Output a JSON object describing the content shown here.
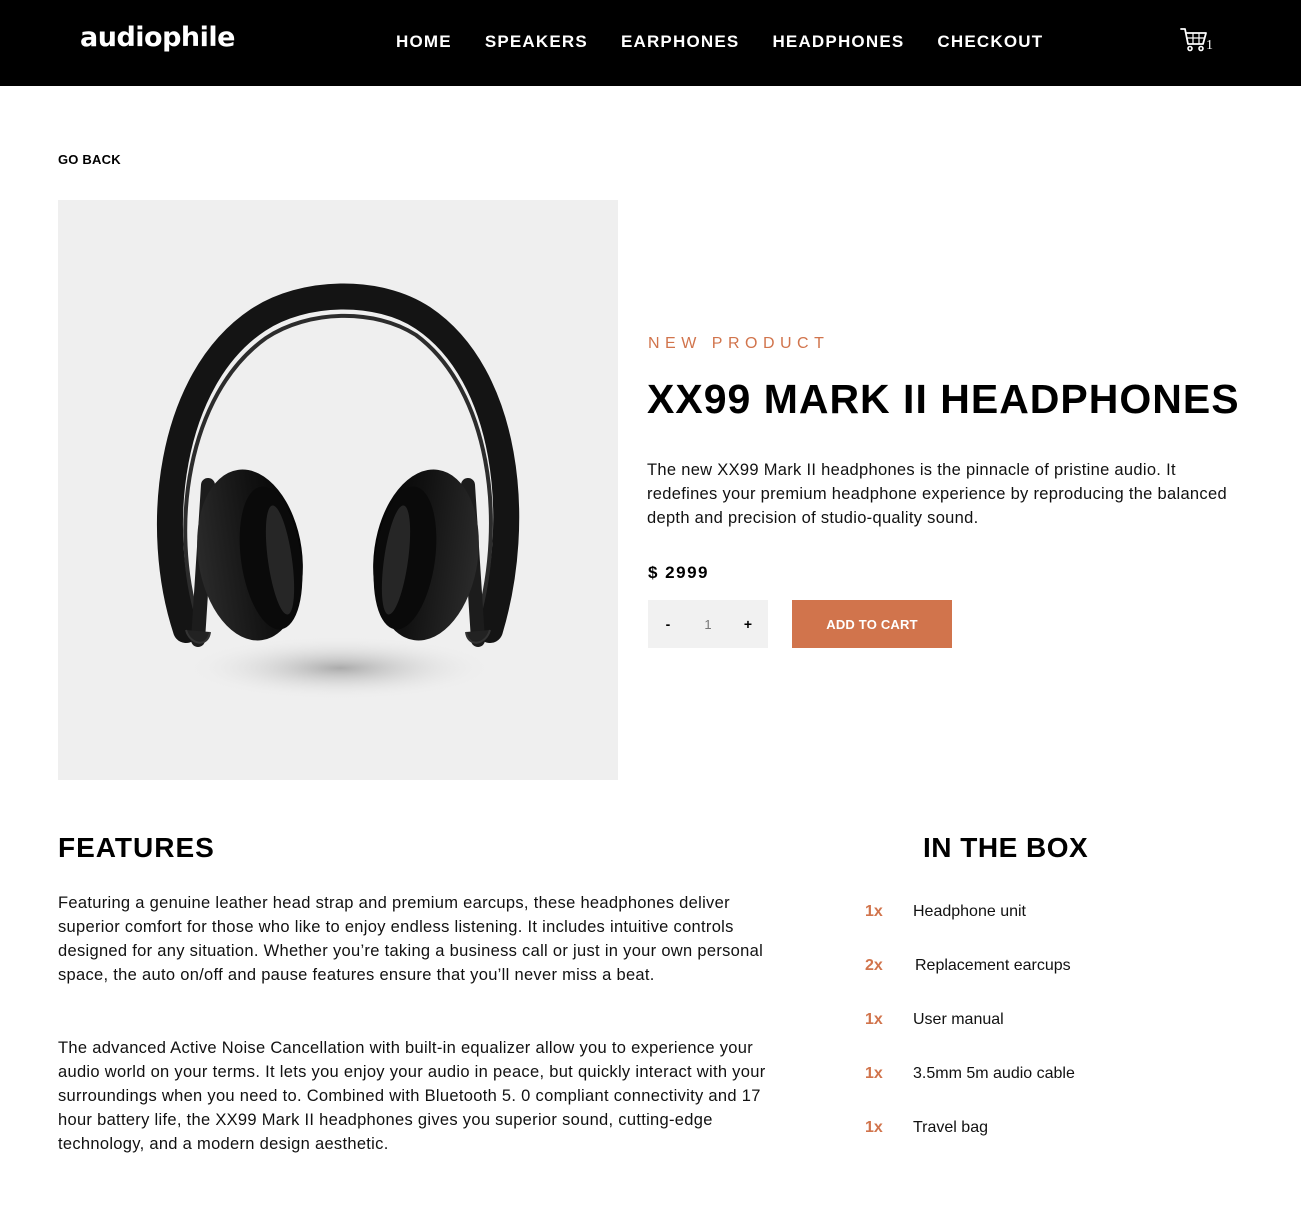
{
  "header": {
    "logo": "audiophile",
    "nav": [
      "HOME",
      "SPEAKERS",
      "EARPHONES",
      "HEADPHONES",
      "CHECKOUT"
    ],
    "cart_icon": "cart-icon",
    "cart_count": "1"
  },
  "go_back": "GO BACK",
  "product": {
    "overline": "NEW PRODUCT",
    "title": "XX99 MARK II HEADPHONES",
    "description": "The new XX99 Mark II headphones is the pinnacle of pristine audio. It redefines your premium headphone experience by reproducing the balanced depth and precision of studio-quality sound.",
    "price": "$ 2999",
    "quantity": {
      "minus": "-",
      "value": "1",
      "plus": "+"
    },
    "add_to_cart": "ADD TO CART",
    "image": "headphones-image"
  },
  "features": {
    "title": "FEATURES",
    "paragraph_1": "Featuring a genuine leather head strap and premium earcups, these headphones deliver superior comfort for those who like to enjoy endless listening. It includes intuitive controls designed for any situation. Whether you’re taking a business call or just in your own personal space, the auto on/off and pause features ensure that you’ll never miss a beat.",
    "paragraph_2": "The advanced Active Noise Cancellation with built-in equalizer allow you to experience your audio world on your terms. It lets you enjoy your audio in peace, but quickly interact with your surroundings when you need to. Combined with Bluetooth 5. 0 compliant connectivity and 17 hour battery life, the XX99 Mark II headphones gives you superior sound, cutting-edge technology, and a modern design aesthetic."
  },
  "in_the_box": {
    "title": "IN THE BOX",
    "items": [
      {
        "qty": "1x",
        "name": "Headphone unit"
      },
      {
        "qty": "2x",
        "name": "Replacement earcups"
      },
      {
        "qty": "1x",
        "name": "User manual"
      },
      {
        "qty": "1x",
        "name": "3.5mm 5m audio cable"
      },
      {
        "qty": "1x",
        "name": "Travel bag"
      }
    ]
  },
  "colors": {
    "accent": "#d1744c",
    "header_bg": "#000000",
    "image_bg": "#efefef",
    "qty_bg": "#f1f1f1"
  }
}
